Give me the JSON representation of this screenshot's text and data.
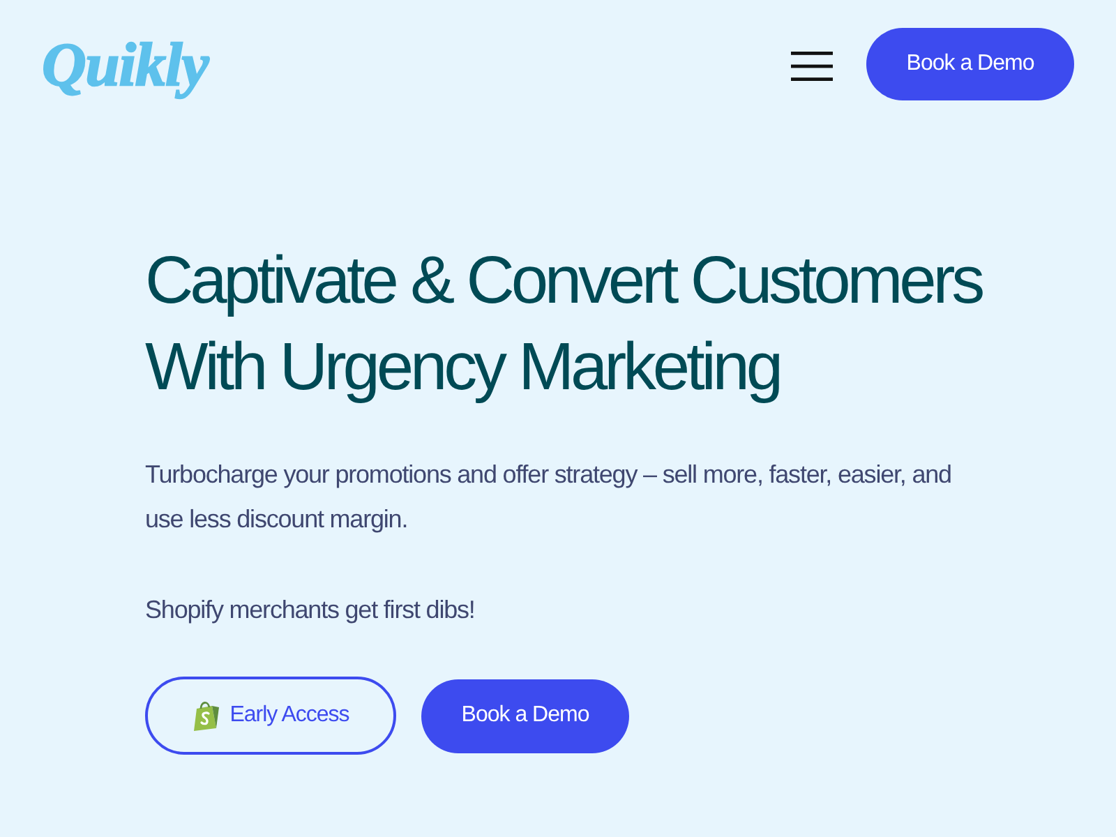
{
  "header": {
    "logo": "Quikly",
    "menu_button": {
      "kind": "hamburger"
    },
    "cta": "Book a Demo"
  },
  "hero": {
    "heading": "Captivate & Convert Customers With Urgency Marketing",
    "paragraphs": [
      "Turbocharge your promotions and offer strategy – sell more, faster, easier, and use less discount margin.",
      "Shopify merchants get first dibs!"
    ],
    "buttons": [
      {
        "label": "Early Access",
        "kind": "outline"
      },
      {
        "label": "Book a Demo",
        "kind": "filled"
      }
    ]
  }
}
